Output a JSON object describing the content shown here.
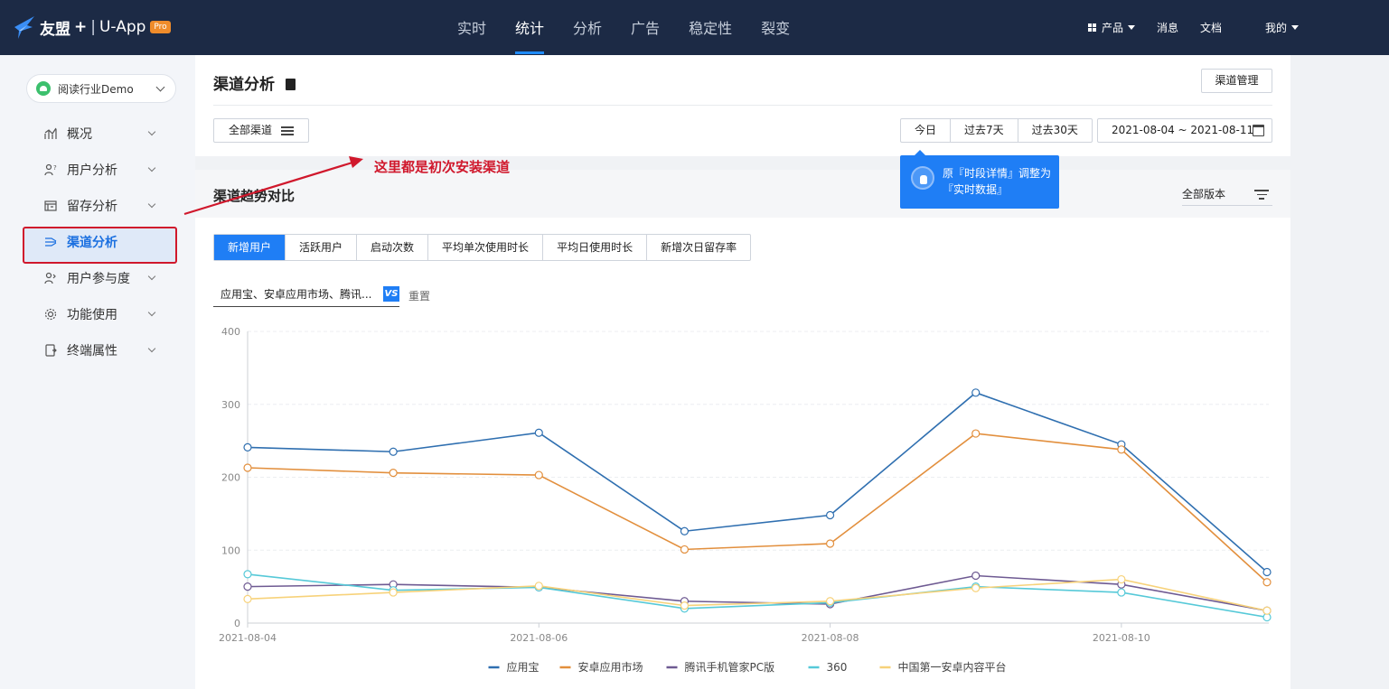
{
  "header": {
    "brand": "友盟",
    "plus": "+",
    "separator": "|",
    "app": "U-App",
    "badge": "Pro",
    "nav": [
      {
        "label": "实时"
      },
      {
        "label": "统计"
      },
      {
        "label": "分析"
      },
      {
        "label": "广告"
      },
      {
        "label": "稳定性"
      },
      {
        "label": "裂变"
      }
    ],
    "active_nav": "统计",
    "right": {
      "product": "产品",
      "messages": "消息",
      "docs": "文档",
      "me": "我的"
    }
  },
  "sidebar": {
    "app_selector": "阅读行业Demo",
    "items": [
      {
        "label": "概况"
      },
      {
        "label": "用户分析"
      },
      {
        "label": "留存分析"
      },
      {
        "label": "渠道分析"
      },
      {
        "label": "用户参与度"
      },
      {
        "label": "功能使用"
      },
      {
        "label": "终端属性"
      }
    ],
    "active_item": "渠道分析"
  },
  "page": {
    "title": "渠道分析",
    "channel_manage": "渠道管理",
    "all_channels": "全部渠道",
    "ranges": [
      "今日",
      "过去7天",
      "过去30天"
    ],
    "date_range": "2021-08-04 ~ 2021-08-11",
    "tooltip_line1": "原『时段详情』调整为",
    "tooltip_line2": "『实时数据』",
    "annotation": "这里都是初次安装渠道"
  },
  "trend": {
    "title": "渠道趋势对比",
    "version": "全部版本",
    "tabs": [
      "新增用户",
      "活跃用户",
      "启动次数",
      "平均单次使用时长",
      "平均日使用时长",
      "新增次日留存率"
    ],
    "active_tab": "新增用户",
    "channel_select": "应用宝、安卓应用市场、腾讯...",
    "vs": "VS",
    "reset": "重置"
  },
  "chart_data": {
    "type": "line",
    "x": [
      "2021-08-04",
      "2021-08-05",
      "2021-08-06",
      "2021-08-07",
      "2021-08-08",
      "2021-08-09",
      "2021-08-10",
      "2021-08-11"
    ],
    "xticks": [
      "2021-08-04",
      "2021-08-06",
      "2021-08-08",
      "2021-08-10"
    ],
    "ylim": [
      0,
      400
    ],
    "yticks": [
      0,
      100,
      200,
      300,
      400
    ],
    "grid": true,
    "legend_position": "bottom",
    "series": [
      {
        "name": "应用宝",
        "color": "#2f6fb0",
        "values": [
          241,
          235,
          261,
          126,
          148,
          316,
          245,
          70
        ]
      },
      {
        "name": "安卓应用市场",
        "color": "#e28f3d",
        "values": [
          213,
          206,
          203,
          101,
          109,
          260,
          238,
          56
        ]
      },
      {
        "name": "腾讯手机管家PC版",
        "color": "#6e5a92",
        "values": [
          50,
          53,
          49,
          30,
          26,
          65,
          53,
          17
        ]
      },
      {
        "name": "360",
        "color": "#56c9d8",
        "values": [
          67,
          45,
          49,
          20,
          28,
          50,
          42,
          8
        ]
      },
      {
        "name": "中国第一安卓内容平台",
        "color": "#f7d27a",
        "values": [
          33,
          42,
          51,
          24,
          30,
          48,
          60,
          17
        ]
      }
    ]
  }
}
